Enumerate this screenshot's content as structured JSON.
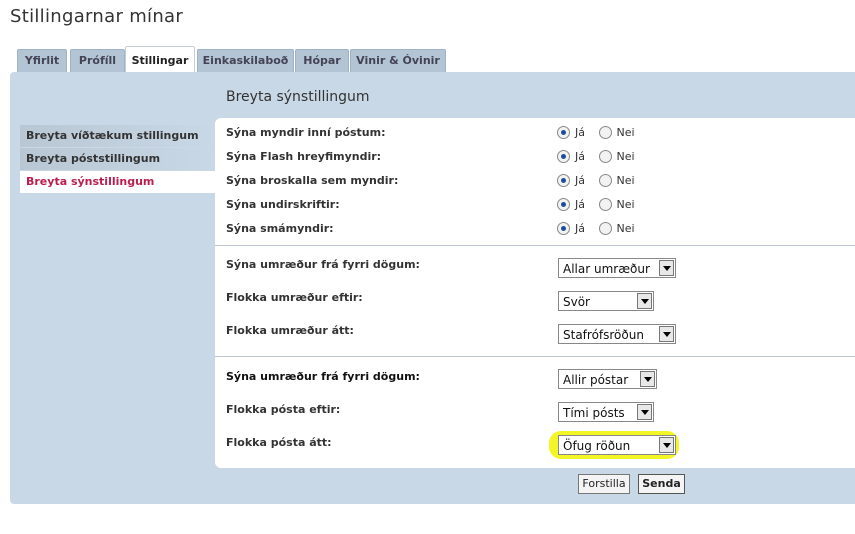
{
  "page": {
    "title": "Stillingarnar mínar"
  },
  "tabs": [
    {
      "label": "Yfirlit",
      "active": false
    },
    {
      "label": "Prófíll",
      "active": false
    },
    {
      "label": "Stillingar",
      "active": true
    },
    {
      "label": "Einkaskilaboð",
      "active": false
    },
    {
      "label": "Hópar",
      "active": false
    },
    {
      "label": "Vinir & Óvinir",
      "active": false
    }
  ],
  "section_title": "Breyta sýnstillingum",
  "sidenav": [
    {
      "label": "Breyta víðtækum stillingum",
      "active": false
    },
    {
      "label": "Breyta póststillingum",
      "active": false
    },
    {
      "label": "Breyta sýnstillingum",
      "active": true
    }
  ],
  "radio_options": {
    "yes": "Já",
    "no": "Nei"
  },
  "radio_settings": [
    {
      "label": "Sýna myndir inní póstum:",
      "value": "yes"
    },
    {
      "label": "Sýna Flash hreyfimyndir:",
      "value": "yes"
    },
    {
      "label": "Sýna broskalla sem myndir:",
      "value": "yes"
    },
    {
      "label": "Sýna undirskriftir:",
      "value": "yes"
    },
    {
      "label": "Sýna smámyndir:",
      "value": "yes"
    }
  ],
  "topic_settings": [
    {
      "label": "Sýna umræður frá fyrri dögum:",
      "value": "Allar umræður"
    },
    {
      "label": "Flokka umræður eftir:",
      "value": "Svör"
    },
    {
      "label": "Flokka umræður átt:",
      "value": "Stafrófsröðun"
    }
  ],
  "post_settings": [
    {
      "label": "Sýna umræður frá fyrri dögum:",
      "value": "Allir póstar"
    },
    {
      "label": "Flokka pósta eftir:",
      "value": "Tími pósts"
    },
    {
      "label": "Flokka pósta átt:",
      "value": "Öfug röðun"
    }
  ],
  "buttons": {
    "reset": "Forstilla",
    "submit": "Senda"
  },
  "colors": {
    "panel": "#c9d8e6",
    "tab": "#b3c4d4",
    "active_nav": "#bb1d4f",
    "highlight": "#f4f527"
  }
}
